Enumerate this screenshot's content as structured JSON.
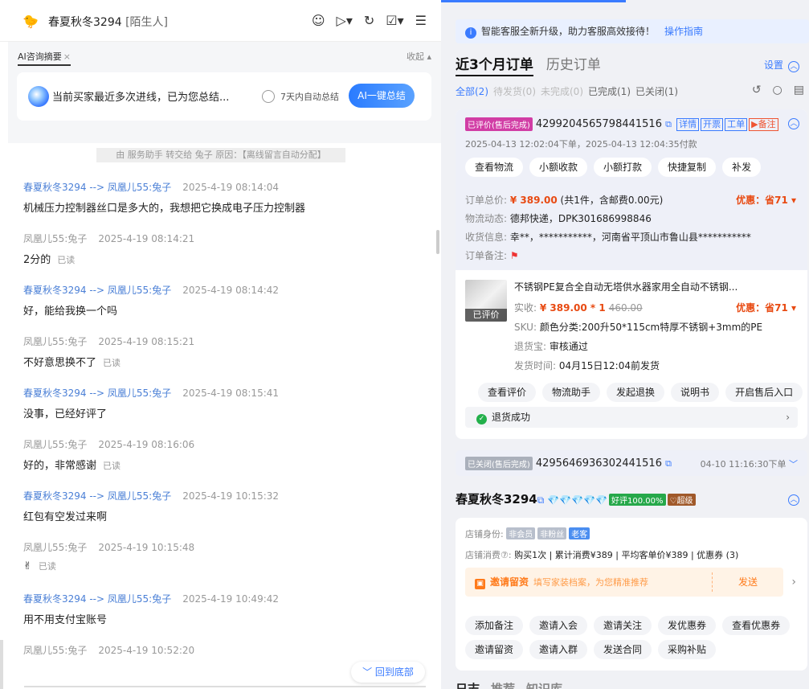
{
  "chat": {
    "header": {
      "avatar_emoji": "🐤",
      "name": "春夏秋冬3294",
      "tag": "[陌生人]",
      "icons": [
        "robot-icon",
        "video-icon",
        "refresh-icon",
        "check-icon",
        "menu-icon"
      ]
    },
    "ai": {
      "tab": "AI咨询摘要",
      "tab_close": "×",
      "collapse": "收起 ▴",
      "summary": "当前买家最近多次进线，已为您总结...",
      "auto_label": "7天内自动总结",
      "button": "AI一键总结"
    },
    "system_msg": "由 服务助手 转交给 兔子 原因：【离线留言自动分配】",
    "messages": [
      {
        "from": "春夏秋冬3294 --> 凤凰儿55:兔子",
        "time": "2025-4-19 08:14:04",
        "text": "机械压力控制器丝口是多大的，我想把它换成电子压力控制器",
        "read": "",
        "buyer": true
      },
      {
        "from": "凤凰儿55:兔子",
        "time": "2025-4-19 08:14:21",
        "text": "2分的",
        "read": "已读",
        "buyer": false
      },
      {
        "from": "春夏秋冬3294 --> 凤凰儿55:兔子",
        "time": "2025-4-19 08:14:42",
        "text": "好，能给我换一个吗",
        "read": "",
        "buyer": true
      },
      {
        "from": "凤凰儿55:兔子",
        "time": "2025-4-19 08:15:21",
        "text": "不好意思换不了",
        "read": "已读",
        "buyer": false
      },
      {
        "from": "春夏秋冬3294 --> 凤凰儿55:兔子",
        "time": "2025-4-19 08:15:41",
        "text": "没事，已经好评了",
        "read": "",
        "buyer": true
      },
      {
        "from": "凤凰儿55:兔子",
        "time": "2025-4-19 08:16:06",
        "text": "好的，非常感谢",
        "read": "已读",
        "buyer": false
      },
      {
        "from": "春夏秋冬3294 --> 凤凰儿55:兔子",
        "time": "2025-4-19 10:15:32",
        "text": "红包有空发过来啊",
        "read": "",
        "buyer": true
      },
      {
        "from": "凤凰儿55:兔子",
        "time": "2025-4-19 10:15:48",
        "text": "✌",
        "read": "已读",
        "buyer": false
      },
      {
        "from": "春夏秋冬3294 --> 凤凰儿55:兔子",
        "time": "2025-4-19 10:49:42",
        "text": "用不用支付宝账号",
        "read": "",
        "buyer": true
      },
      {
        "from": "凤凰儿55:兔子",
        "time": "2025-4-19 10:52:20",
        "text": "",
        "read": "",
        "buyer": false
      }
    ],
    "to_bottom": "﹀ 回到底部"
  },
  "panel": {
    "notice": "智能客服全新升级，助力客服高效接待！",
    "notice_link": "操作指南",
    "tabs": [
      "近3个月订单",
      "历史订单"
    ],
    "settings": "设置",
    "filters": [
      {
        "label": "全部(2)",
        "state": "on"
      },
      {
        "label": "待发货(0)",
        "state": "dis"
      },
      {
        "label": "未完成(0)",
        "state": "dis"
      },
      {
        "label": "已完成(1)",
        "state": "norm"
      },
      {
        "label": "已关闭(1)",
        "state": "norm"
      }
    ],
    "order1": {
      "status": "已评价(售后完成)",
      "id": "4299204565798441516",
      "tags": [
        "详情",
        "开票",
        "工单",
        "▶备注"
      ],
      "time": "2025-04-13 12:02:04下单，2025-04-13 12:04:35付款",
      "buttons": [
        "查看物流",
        "小额收款",
        "小额打款",
        "快捷复制",
        "补发"
      ],
      "total_label": "订单总价:",
      "total_price": "¥ 389.00",
      "total_extra": "(共1件，含邮费0.00元)",
      "discount": "优惠：省71 ▾",
      "logistics_label": "物流动态:",
      "logistics": "德邦快递，DPK301686998846",
      "receiver_label": "收货信息:",
      "receiver": "幸**，***********，河南省平顶山市鲁山县***********",
      "note_label": "订单备注:",
      "note_flag": "⚑",
      "product": {
        "img_label": "已评价",
        "title": "不锈钢PE复合全自动无塔供水器家用全自动不锈钢...",
        "paid_label": "实收:",
        "paid": "¥ 389.00 * 1",
        "orig": "460.00",
        "discount": "优惠：省71 ▾",
        "sku_label": "SKU:",
        "sku": "颜色分类:200升50*115cm特厚不锈钢+3mm的PE",
        "return_label": "退货宝:",
        "return": "审核通过",
        "ship_label": "发货时间:",
        "ship": "04月15日12:04前发货"
      },
      "actions": [
        "查看评价",
        "物流助手",
        "发起退换",
        "说明书",
        "开启售后入口"
      ],
      "refund": "退货成功"
    },
    "order2": {
      "status": "已关闭(售后完成)",
      "id": "4295646936302441516",
      "time": "04-10 11:16:30下单"
    },
    "customer": {
      "name": "春夏秋冬3294",
      "diamonds": "💎💎💎💎💎",
      "good": "好评100.00%",
      "level": "♡超级",
      "identity_label": "店铺身份:",
      "identity_tags": [
        {
          "t": "非会员",
          "c": "g"
        },
        {
          "t": "非粉丝",
          "c": "g"
        },
        {
          "t": "老客",
          "c": "b"
        }
      ],
      "consume_label": "店铺消费⑦:",
      "consume": "购买1次 | 累计消费¥389 | 平均客单价¥389 | 优惠券 (3)",
      "invite_title": "邀请留资",
      "invite_desc": "填写家装档案，为您精准推荐",
      "invite_send": "发送",
      "buttons1": [
        "添加备注",
        "邀请入会",
        "邀请关注",
        "发优惠券",
        "查看优惠券"
      ],
      "buttons2": [
        "邀请留资",
        "邀请入群",
        "发送合同",
        "采购补贴"
      ]
    },
    "bottom_tabs": [
      "日志",
      "推荐",
      "知识库"
    ]
  }
}
